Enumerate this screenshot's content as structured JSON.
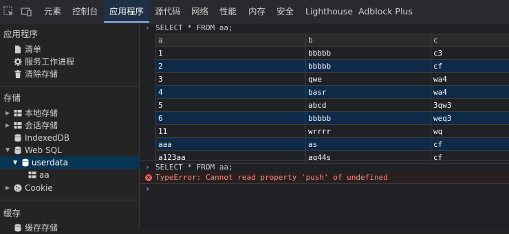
{
  "toolbar": {
    "tabs": [
      "元素",
      "控制台",
      "应用程序",
      "源代码",
      "网络",
      "性能",
      "内存",
      "安全",
      "Lighthouse",
      "Adblock Plus"
    ],
    "active_tab": "应用程序"
  },
  "sidebar": {
    "application_header": "应用程序",
    "application_items": [
      "清单",
      "服务工作进程",
      "清除存储"
    ],
    "storage_header": "存储",
    "storage_items": [
      "本地存储",
      "会话存储",
      "IndexedDB",
      "Web SQL",
      "userdata",
      "aa",
      "Cookie"
    ],
    "cache_header": "缓存",
    "cache_items": [
      "缓存存储"
    ]
  },
  "console": {
    "query1": "SELECT * FROM aa;",
    "columns": [
      "a",
      "b",
      "c"
    ],
    "rows": [
      [
        "1",
        "bbbbb",
        "c3"
      ],
      [
        "2",
        "bbbbb",
        "cf"
      ],
      [
        "3",
        "qwe",
        "wa4"
      ],
      [
        "4",
        "basr",
        "wa4"
      ],
      [
        "5",
        "abcd",
        "3qw3"
      ],
      [
        "6",
        "bbbbb",
        "weq3"
      ],
      [
        "11",
        "wrrrr",
        "wq"
      ],
      [
        "aaa",
        "as",
        "cf"
      ],
      [
        "a123aa",
        "aq44s",
        "cf"
      ]
    ],
    "query2": "SELECT * FROM aa;",
    "error": "TypeError: Cannot read property 'push' of undefined"
  },
  "colors": {
    "accent": "#8ab4f8",
    "selected_row": "#073655",
    "error": "#f28b82"
  }
}
